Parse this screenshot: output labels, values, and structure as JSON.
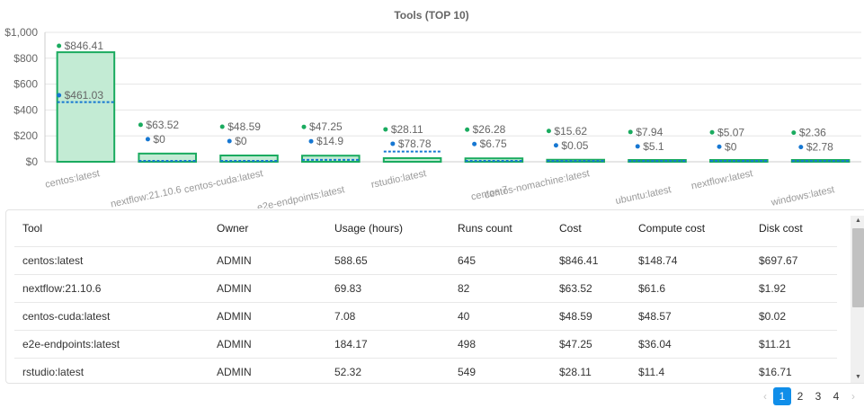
{
  "chart_data": {
    "type": "bar",
    "title": "Tools  (TOP 10)",
    "categories": [
      "centos:latest",
      "nextflow:21.10.6",
      "centos-cuda:latest",
      "e2e-endpoints:latest",
      "rstudio:latest",
      "centos:7",
      "centos-nomachine:latest",
      "ubuntu:latest",
      "nextflow:latest",
      "windows:latest"
    ],
    "series": [
      {
        "values": [
          846.41,
          63.52,
          48.59,
          47.25,
          28.11,
          26.28,
          15.62,
          7.94,
          5.07,
          2.36
        ],
        "labels": [
          "$846.41",
          "$63.52",
          "$48.59",
          "$47.25",
          "$28.11",
          "$26.28",
          "$15.62",
          "$7.94",
          "$5.07",
          "$2.36"
        ],
        "color": "#1aab5f"
      },
      {
        "values": [
          461.03,
          0,
          0,
          14.9,
          78.78,
          6.75,
          0.05,
          5.1,
          0,
          2.78
        ],
        "labels": [
          "$461.03",
          "$0",
          "$0",
          "$14.9",
          "$78.78",
          "$6.75",
          "$0.05",
          "$5.1",
          "$0",
          "$2.78"
        ],
        "color": "#1677d2"
      }
    ],
    "yticks": [
      "$0",
      "$200",
      "$400",
      "$600",
      "$800",
      "$1,000"
    ],
    "ylim": [
      0,
      1000
    ],
    "grid": true
  },
  "table": {
    "headers": [
      "Tool",
      "Owner",
      "Usage (hours)",
      "Runs count",
      "Cost",
      "Compute cost",
      "Disk cost"
    ],
    "rows": [
      [
        "centos:latest",
        "ADMIN",
        "588.65",
        "645",
        "$846.41",
        "$148.74",
        "$697.67"
      ],
      [
        "nextflow:21.10.6",
        "ADMIN",
        "69.83",
        "82",
        "$63.52",
        "$61.6",
        "$1.92"
      ],
      [
        "centos-cuda:latest",
        "ADMIN",
        "7.08",
        "40",
        "$48.59",
        "$48.57",
        "$0.02"
      ],
      [
        "e2e-endpoints:latest",
        "ADMIN",
        "184.17",
        "498",
        "$47.25",
        "$36.04",
        "$11.21"
      ],
      [
        "rstudio:latest",
        "ADMIN",
        "52.32",
        "549",
        "$28.11",
        "$11.4",
        "$16.71"
      ]
    ]
  },
  "scrollbar": {
    "up": "▲",
    "down": "▼"
  },
  "pagination": {
    "prev": "‹",
    "pages": [
      "1",
      "2",
      "3",
      "4"
    ],
    "current": "1",
    "next": "›"
  },
  "colors": {
    "accent": "#108ee9",
    "bar_fill": "#c3ebd4",
    "bar_stroke": "#1aab5f",
    "dash": "#1677d2"
  }
}
